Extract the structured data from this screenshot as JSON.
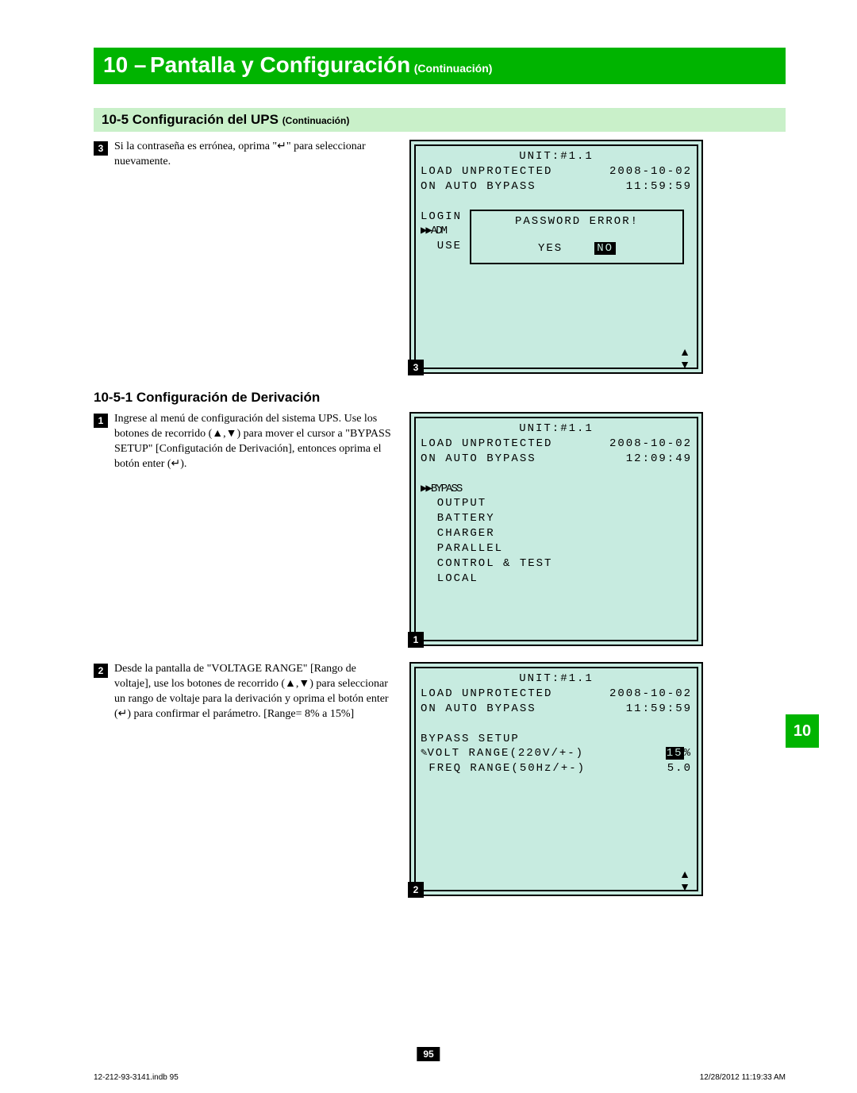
{
  "chapter": {
    "number": "10 –",
    "title": "Pantalla y Configuración",
    "cont": "(Continuación)"
  },
  "section": {
    "number": "10-5",
    "title": "Configuración del UPS",
    "cont": "(Continuación)"
  },
  "step3": {
    "num": "3",
    "text": "Si la contraseña es errónea, oprima \"↵\" para seleccionar nuevamente."
  },
  "lcd3": {
    "caption": "3",
    "unit": "UNIT:#1.1",
    "l1a": "LOAD UNPROTECTED",
    "l1b": "2008-10-02",
    "l2a": "ON AUTO BYPASS",
    "l2b": "11:59:59",
    "login": "LOGIN",
    "adm": "▶▶ADM",
    "use": "  USE",
    "dlg_msg": "PASSWORD ERROR!",
    "yes": "YES",
    "no": "NO"
  },
  "subsection": {
    "title": "10-5-1 Configuración de Derivación"
  },
  "step1": {
    "num": "1",
    "text": "Ingrese al menú de configuración del sistema UPS. Use los botones de recorrido (▲,▼) para mover el cursor a \"BYPASS SETUP\" [Configutación de Derivación], entonces oprima el botón enter (↵)."
  },
  "lcd1": {
    "caption": "1",
    "unit": "UNIT:#1.1",
    "l1a": "LOAD UNPROTECTED",
    "l1b": "2008-10-02",
    "l2a": "ON AUTO BYPASS",
    "l2b": "12:09:49",
    "m1": "▶▶BYPASS",
    "m2": "  OUTPUT",
    "m3": "  BATTERY",
    "m4": "  CHARGER",
    "m5": "  PARALLEL",
    "m6": "  CONTROL & TEST",
    "m7": "  LOCAL"
  },
  "step2": {
    "num": "2",
    "text": "Desde la pantalla de \"VOLTAGE RANGE\" [Rango de voltaje], use los botones de recorrido (▲,▼) para seleccionar un rango de voltaje para la derivación y oprima el botón enter (↵) para confirmar el parámetro. [Range= 8% a 15%]"
  },
  "lcd2": {
    "caption": "2",
    "unit": "UNIT:#1.1",
    "l1a": "LOAD UNPROTECTED",
    "l1b": "2008-10-02",
    "l2a": "ON AUTO BYPASS",
    "l2b": "11:59:59",
    "title": "BYPASS SETUP",
    "r1a": "VOLT RANGE(220V/+-)",
    "r1b_hl": "15",
    "r1b_suf": "%",
    "r2a": " FREQ RANGE(50Hz/+-)",
    "r2b": "5.0"
  },
  "sidetab": "10",
  "pagenum": "95",
  "footer": {
    "left": "12-212-93-3141.indb   95",
    "right": "12/28/2012   11:19:33 AM"
  }
}
